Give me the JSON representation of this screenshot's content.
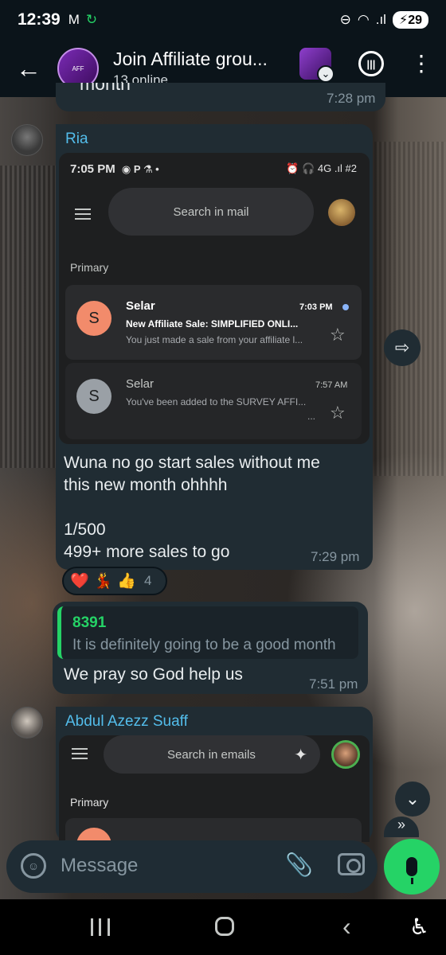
{
  "status_bar": {
    "time": "12:39",
    "battery": "29",
    "left_icons": [
      "gmail-icon",
      "sync-icon"
    ],
    "right_icons": [
      "dnd-icon",
      "wifi-icon",
      "signal-icon",
      "battery-icon"
    ]
  },
  "header": {
    "title": "Join Affiliate grou...",
    "subtitle": "13 online"
  },
  "previous_message": {
    "text_cut": "month",
    "time": "7:28 pm"
  },
  "message_ria": {
    "sender": "Ria",
    "sender_color": "#53bdeb",
    "screenshot": {
      "status_time": "7:05 PM",
      "status_icons": "◉  P  ⚗  •",
      "status_right": "⏰ 🎧 4G .ıl #2",
      "search_placeholder": "Search in mail",
      "section_label": "Primary",
      "emails": [
        {
          "avatar_letter": "S",
          "avatar_color": "#f28b6b",
          "from": "Selar",
          "time": "7:03 PM",
          "subject": "New Affiliate Sale: SIMPLIFIED ONLI...",
          "snippet": "You just made a sale from your affiliate l...",
          "unread": true
        },
        {
          "avatar_letter": "S",
          "avatar_color": "#9aa0a6",
          "from": "Selar",
          "time": "7:57 AM",
          "subject": "",
          "snippet": "You've been added to the SURVEY AFFI...",
          "snippet2": "...",
          "unread": false
        }
      ]
    },
    "text": "Wuna no go start sales without me\nthis new month ohhhh\n\n1/500\n499+ more sales to go",
    "time": "7:29 pm",
    "reactions": {
      "emojis": [
        "❤️",
        "💃",
        "👍"
      ],
      "count": "4"
    }
  },
  "message_reply": {
    "quoted_name": "8391",
    "quoted_text": "It is definitely going to be a good month",
    "text": "We pray so God help us",
    "time": "7:51 pm"
  },
  "message_abdul": {
    "sender": "Abdul Azezz Suaff",
    "sender_color": "#53bdeb",
    "screenshot": {
      "search_placeholder": "Search in emails",
      "section_label": "Primary"
    }
  },
  "composer": {
    "placeholder": "Message"
  },
  "icons": {
    "back": "back-arrow-icon",
    "voice_chat": "voice-chat-icon",
    "menu": "more-vert-icon",
    "forward": "forward-icon",
    "scroll_down": "scroll-down-icon",
    "emoji": "sticker-icon",
    "attach": "paperclip-icon",
    "camera": "camera-icon",
    "mic": "mic-icon"
  },
  "colors": {
    "accent_green": "#25d366",
    "bubble_bg": "#202c33",
    "header_bg": "#0b141a"
  }
}
